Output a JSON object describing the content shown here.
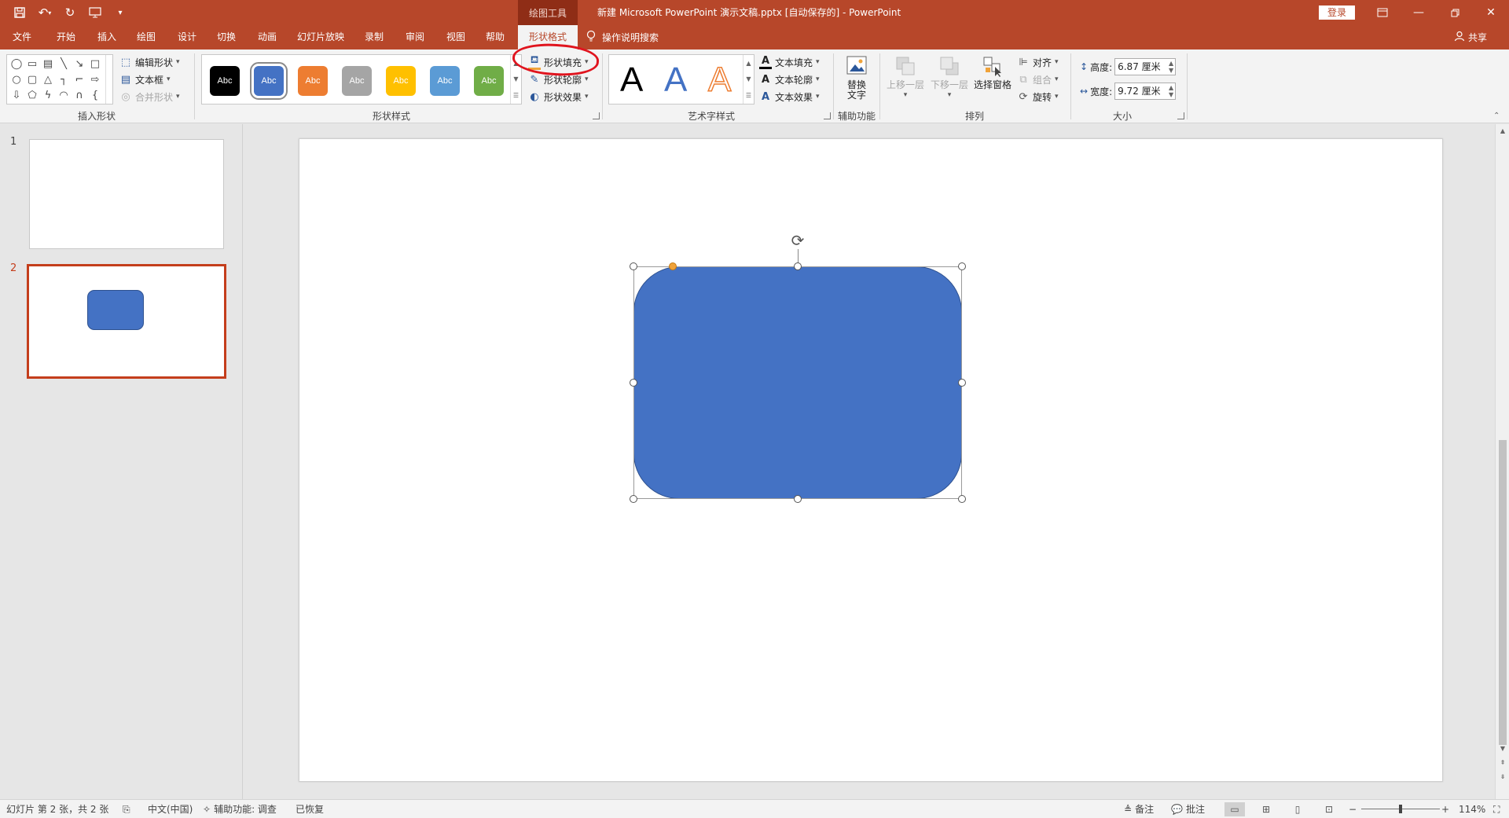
{
  "title_bar": {
    "context_tools": "绘图工具",
    "document_title": "新建 Microsoft PowerPoint 演示文稿.pptx [自动保存的]  -  PowerPoint",
    "login": "登录"
  },
  "tabs": [
    "文件",
    "开始",
    "插入",
    "绘图",
    "设计",
    "切换",
    "动画",
    "幻灯片放映",
    "录制",
    "审阅",
    "视图",
    "帮助",
    "形状格式"
  ],
  "active_tab": "形状格式",
  "tell_me": "操作说明搜索",
  "share": "共享",
  "ribbon": {
    "insert_shapes": {
      "label": "插入形状",
      "edit_shape": "编辑形状",
      "text_box": "文本框",
      "merge_shapes": "合并形状"
    },
    "shape_styles": {
      "label": "形状样式",
      "swatch_text": "Abc",
      "swatches": [
        "#000000",
        "#4472c4",
        "#ed7d31",
        "#a5a5a5",
        "#ffc000",
        "#5b9bd5",
        "#70ad47"
      ],
      "shape_fill": "形状填充",
      "shape_outline": "形状轮廓",
      "shape_effects": "形状效果"
    },
    "wordart_styles": {
      "label": "艺术字样式",
      "letter": "A",
      "text_fill": "文本填充",
      "text_outline": "文本轮廓",
      "text_effects": "文本效果"
    },
    "accessibility": {
      "label": "辅助功能",
      "alt_text_line1": "替换",
      "alt_text_line2": "文字"
    },
    "arrange": {
      "label": "排列",
      "bring_forward": "上移一层",
      "send_backward": "下移一层",
      "selection_pane": "选择窗格",
      "align": "对齐",
      "group": "组合",
      "rotate": "旋转"
    },
    "size": {
      "label": "大小",
      "height_label": "高度:",
      "height_value": "6.87 厘米",
      "width_label": "宽度:",
      "width_value": "9.72 厘米"
    }
  },
  "slides": [
    {
      "number": "1"
    },
    {
      "number": "2"
    }
  ],
  "current_slide": 2,
  "shape_color": "#4472c4",
  "status_bar": {
    "slide_info": "幻灯片 第 2 张，共 2 张",
    "language": "中文(中国)",
    "accessibility": "辅助功能: 调查",
    "recovered": "已恢复",
    "notes": "备注",
    "comments": "批注",
    "zoom": "114%"
  }
}
